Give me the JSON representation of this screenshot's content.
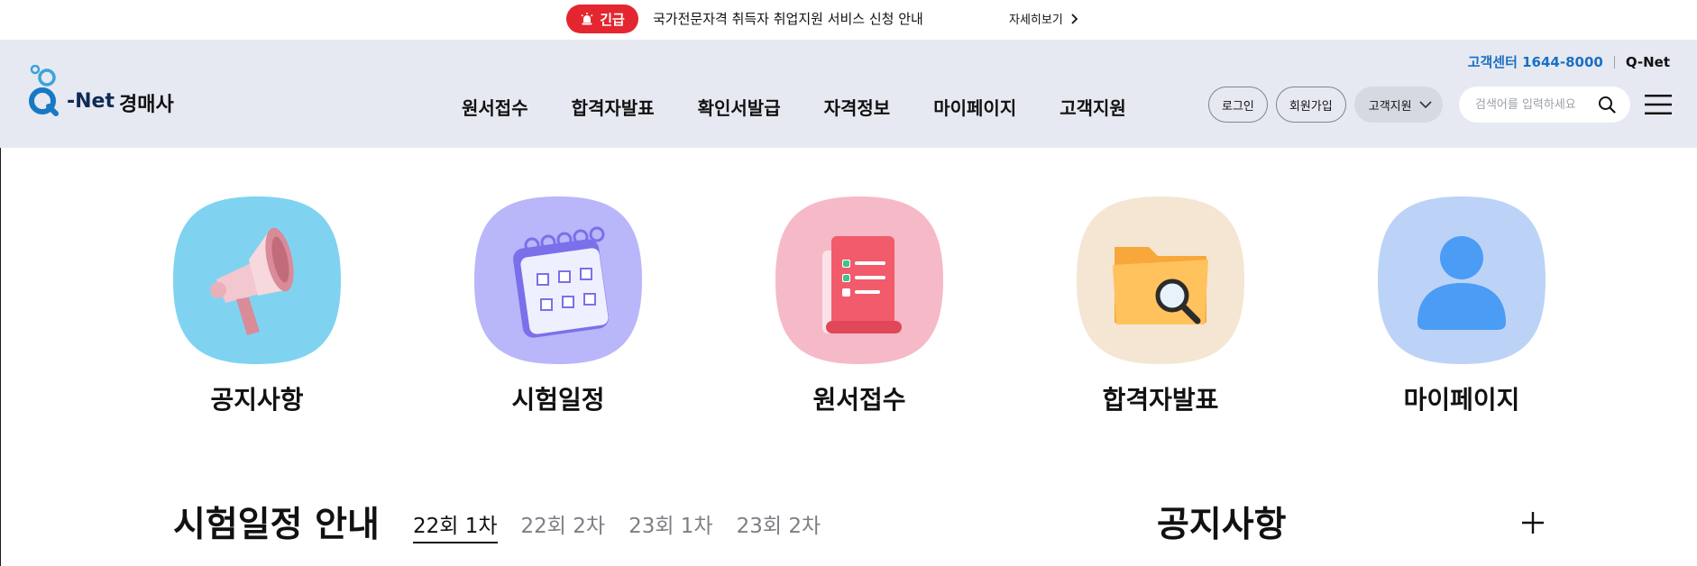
{
  "alert": {
    "badge": "긴급",
    "message": "국가전문자격 취득자 취업지원 서비스 신청 안내",
    "more": "자세히보기"
  },
  "header": {
    "logo_net": "-Net",
    "logo_sub": "경매사",
    "cs_center": "고객센터 1644-8000",
    "qnet": "Q-Net",
    "nav": [
      "원서접수",
      "합격자발표",
      "확인서발급",
      "자격정보",
      "마이페이지",
      "고객지원"
    ],
    "login": "로그인",
    "signup": "회원가입",
    "support_select": "고객지원",
    "search_placeholder": "검색어를 입력하세요"
  },
  "quick_menu": [
    {
      "label": "공지사항",
      "icon": "megaphone-icon",
      "bg": "#7fd3f1"
    },
    {
      "label": "시험일정",
      "icon": "calendar-icon",
      "bg": "#b9b6fa"
    },
    {
      "label": "원서접수",
      "icon": "document-checklist-icon",
      "bg": "#f6b9c8"
    },
    {
      "label": "합격자발표",
      "icon": "folder-search-icon",
      "bg": "#f4e6d2"
    },
    {
      "label": "마이페이지",
      "icon": "user-icon",
      "bg": "#bcd3f7"
    }
  ],
  "schedule": {
    "title": "시험일정 안내",
    "tabs": [
      "22회 1차",
      "22회 2차",
      "23회 1차",
      "23회 2차"
    ],
    "active_tab": 0
  },
  "notice": {
    "title": "공지사항"
  },
  "colors": {
    "alert_red": "#e3262f",
    "header_bg": "#e6e9f1",
    "cs_blue": "#1a6fc4"
  }
}
